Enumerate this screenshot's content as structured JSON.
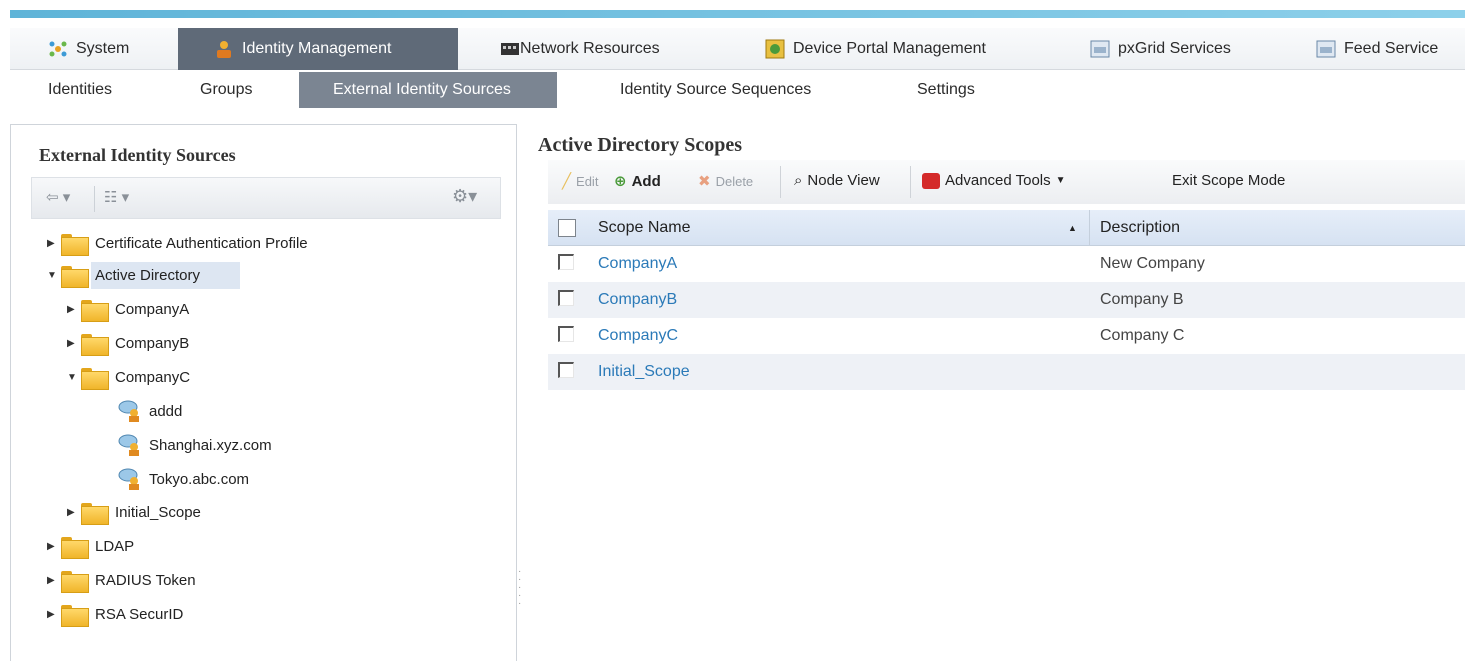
{
  "top_tabs": [
    {
      "label": "System",
      "icon": "system-icon"
    },
    {
      "label": "Identity Management",
      "icon": "identity-icon"
    },
    {
      "label": "Network Resources",
      "icon": "network-icon"
    },
    {
      "label": "Device Portal Management",
      "icon": "portal-icon"
    },
    {
      "label": "pxGrid Services",
      "icon": "pxgrid-icon"
    },
    {
      "label": "Feed Service",
      "icon": "feed-icon"
    }
  ],
  "sub_tabs": [
    {
      "label": "Identities"
    },
    {
      "label": "Groups"
    },
    {
      "label": "External Identity Sources"
    },
    {
      "label": "Identity Source Sequences"
    },
    {
      "label": "Settings"
    }
  ],
  "left_panel": {
    "title": "External Identity Sources",
    "tree": [
      {
        "label": "Certificate Authentication Profile"
      },
      {
        "label": "Active Directory"
      },
      {
        "label": "CompanyA"
      },
      {
        "label": "CompanyB"
      },
      {
        "label": "CompanyC"
      },
      {
        "label": "addd"
      },
      {
        "label": "Shanghai.xyz.com"
      },
      {
        "label": "Tokyo.abc.com"
      },
      {
        "label": "Initial_Scope"
      },
      {
        "label": "LDAP"
      },
      {
        "label": "RADIUS Token"
      },
      {
        "label": "RSA SecurID"
      }
    ]
  },
  "right_panel": {
    "title": "Active Directory Scopes",
    "toolbar": {
      "edit": "Edit",
      "add": "Add",
      "delete": "Delete",
      "node_view": "Node View",
      "advanced_tools": "Advanced Tools",
      "exit_scope": "Exit Scope Mode"
    },
    "columns": {
      "name": "Scope Name",
      "description": "Description"
    },
    "rows": [
      {
        "name": "CompanyA",
        "description": "New Company"
      },
      {
        "name": "CompanyB",
        "description": "Company B"
      },
      {
        "name": "CompanyC",
        "description": "Company C"
      },
      {
        "name": "Initial_Scope",
        "description": ""
      }
    ]
  }
}
